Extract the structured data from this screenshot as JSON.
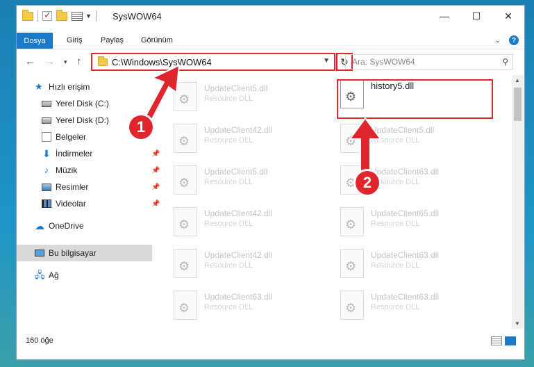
{
  "window": {
    "title": "SysWOW64"
  },
  "ribbon": {
    "tabs": [
      "Dosya",
      "Giriş",
      "Paylaş",
      "Görünüm"
    ],
    "help_label": "?"
  },
  "navigation": {
    "address": "C:\\Windows\\SysWOW64",
    "search_placeholder": "Ara: SysWOW64"
  },
  "sidebar": {
    "items": [
      {
        "label": "Hızlı erişim",
        "icon": "star-icon"
      },
      {
        "label": "Yerel Disk (C:)",
        "icon": "disk-icon"
      },
      {
        "label": "Yerel Disk (D:)",
        "icon": "disk-icon"
      },
      {
        "label": "Belgeler",
        "icon": "documents-icon"
      },
      {
        "label": "İndirmeler",
        "icon": "download-icon"
      },
      {
        "label": "Müzik",
        "icon": "music-icon"
      },
      {
        "label": "Resimler",
        "icon": "pictures-icon"
      },
      {
        "label": "Videolar",
        "icon": "videos-icon"
      },
      {
        "label": "OneDrive",
        "icon": "cloud-icon"
      },
      {
        "label": "Bu bilgisayar",
        "icon": "computer-icon"
      },
      {
        "label": "Ağ",
        "icon": "network-icon"
      }
    ]
  },
  "files": {
    "left_column": [
      {
        "name": "UpdateClient5.dll",
        "type": "Resource DLL"
      },
      {
        "name": "UpdateClient42.dll",
        "type": "Resource DLL"
      },
      {
        "name": "UpdateClient5.dll",
        "type": "Resource DLL"
      },
      {
        "name": "UpdateClient42.dll",
        "type": "Resource DLL"
      },
      {
        "name": "UpdateClient42.dll",
        "type": "Resource DLL"
      },
      {
        "name": "UpdateClient63.dll",
        "type": "Resource DLL"
      }
    ],
    "right_column": [
      {
        "name": "history5.dll",
        "type": ""
      },
      {
        "name": "UpdateClient5.dll",
        "type": "Resource DLL"
      },
      {
        "name": "UpdateClient63.dll",
        "type": "Resource DLL"
      },
      {
        "name": "UpdateClient65.dll",
        "type": "Resource DLL"
      },
      {
        "name": "UpdateClient63.dll",
        "type": "Resource DLL"
      },
      {
        "name": "UpdateClient63.dll",
        "type": "Resource DLL"
      }
    ]
  },
  "status": {
    "item_count": "160 öğe"
  },
  "annotations": {
    "callout_1": "1",
    "callout_2": "2",
    "highlight_color": "#e0252d"
  },
  "colors": {
    "accent": "#1979ca",
    "annotation": "#e0252d"
  }
}
